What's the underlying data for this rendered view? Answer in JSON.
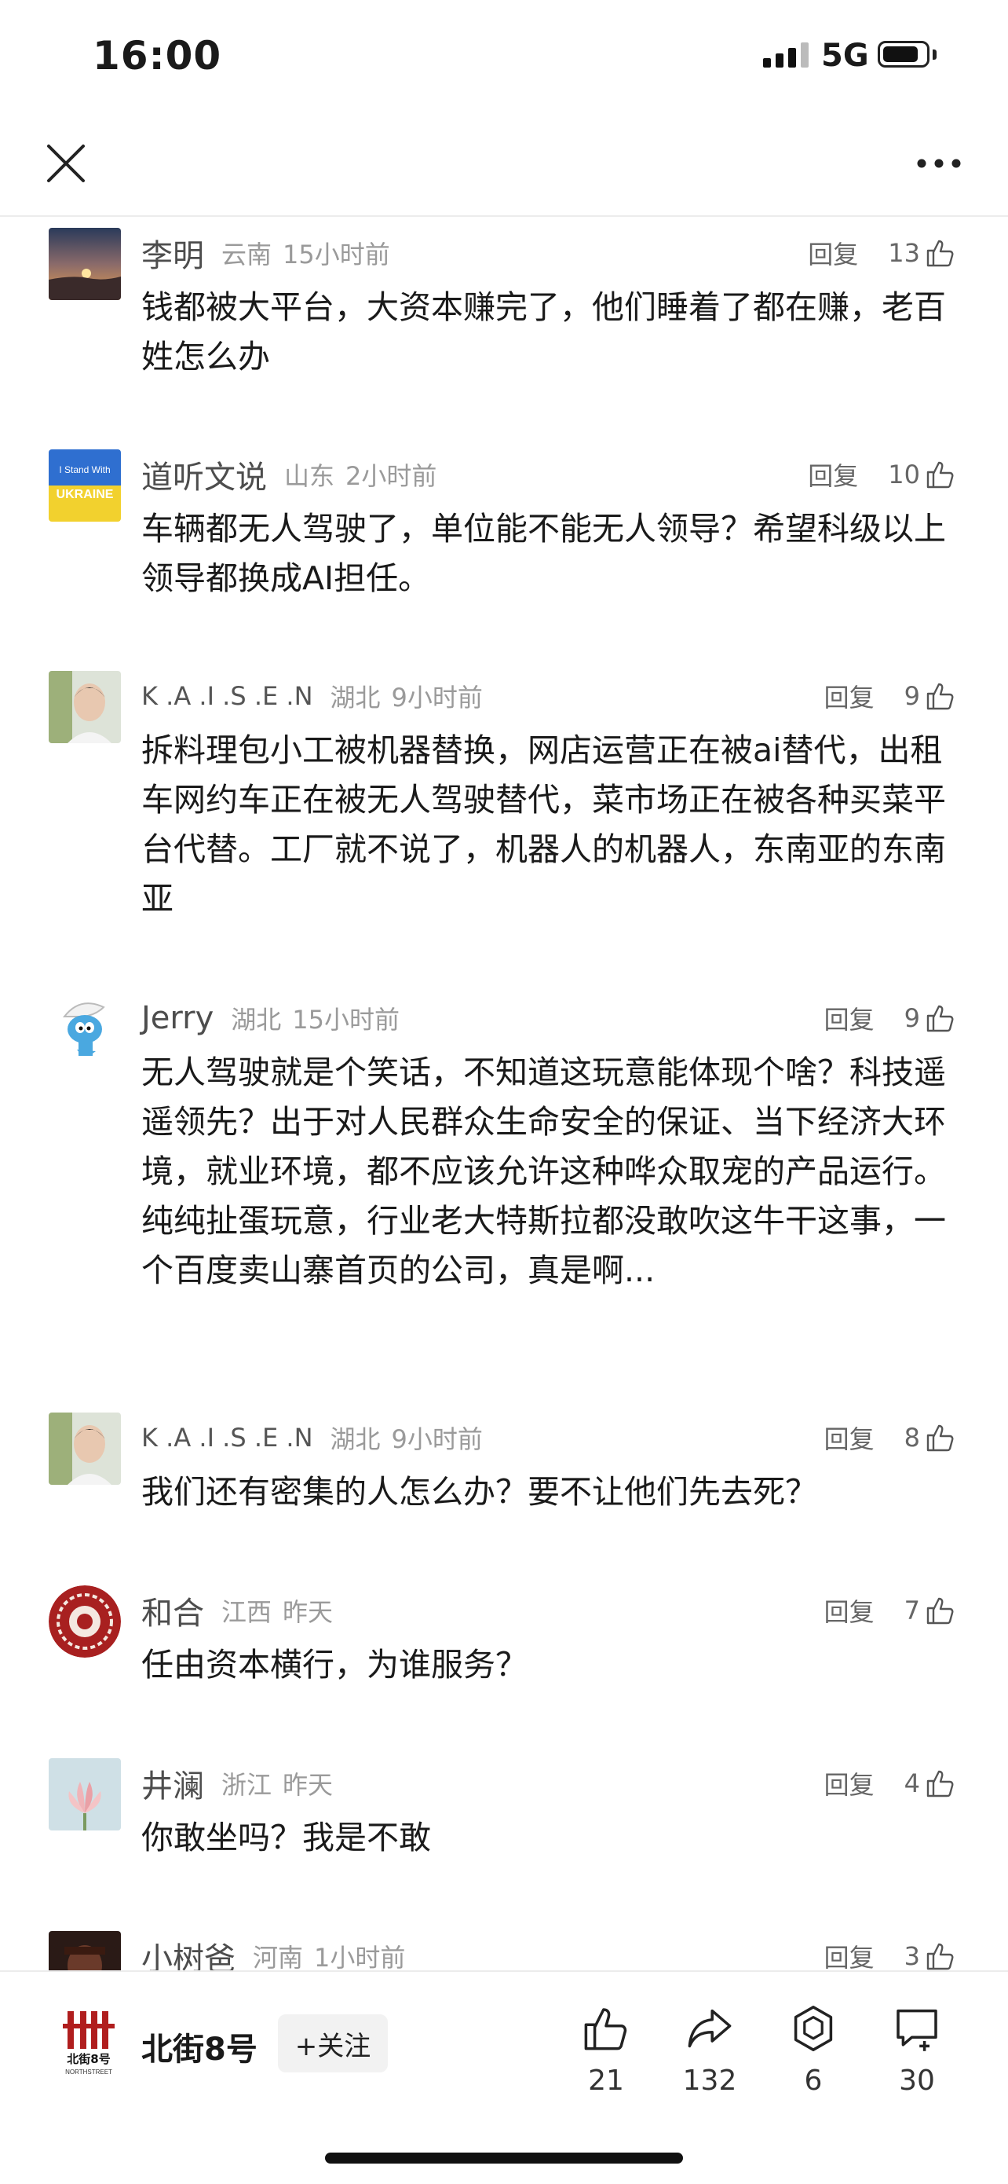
{
  "status_bar": {
    "time": "16:00",
    "network": "5G",
    "battery_level": 0.85
  },
  "nav": {
    "close_icon": "close-icon",
    "more_icon": "more-icon"
  },
  "comments": [
    {
      "name": "李明",
      "location": "云南",
      "time": "15小时前",
      "reply": "回复",
      "likes": "13",
      "text": "钱都被大平台，大资本赚完了，他们睡着了都在赚，老百姓怎么办",
      "avatar": "sunset-avatar"
    },
    {
      "name": "道听文说",
      "location": "山东",
      "time": "2小时前",
      "reply": "回复",
      "likes": "10",
      "text": "车辆都无人驾驶了，单位能不能无人领导？希望科级以上领导都换成AI担任。",
      "avatar": "ukraine-avatar",
      "avatar_text": [
        "I Stand With",
        "UKRAINE"
      ]
    },
    {
      "name": "K .A .I .S .E .N",
      "location": "湖北",
      "time": "9小时前",
      "reply": "回复",
      "likes": "9",
      "text": "拆料理包小工被机器替换，网店运营正在被ai替代，出租车网约车正在被无人驾驶替代，菜市场正在被各种买菜平台代替。工厂就不说了，机器人的机器人，东南亚的东南亚",
      "avatar": "person-avatar"
    },
    {
      "name": "Jerry",
      "location": "湖北",
      "time": "15小时前",
      "reply": "回复",
      "likes": "9",
      "text": "无人驾驶就是个笑话，不知道这玩意能体现个啥？科技遥遥领先？出于对人民群众生命安全的保证、当下经济大环境，就业环境，都不应该允许这种哗众取宠的产品运行。纯纯扯蛋玩意，行业老大特斯拉都没敢吹这牛干这事，一个百度卖山寨首页的公司，真是啊...",
      "avatar": "smurf-avatar"
    },
    {
      "name": "K .A .I .S .E .N",
      "location": "湖北",
      "time": "9小时前",
      "reply": "回复",
      "likes": "8",
      "text": "我们还有密集的人怎么办？要不让他们先去死？",
      "avatar": "person-avatar"
    },
    {
      "name": "和合",
      "location": "江西",
      "time": "昨天",
      "reply": "回复",
      "likes": "7",
      "text": "任由资本横行，为谁服务？",
      "avatar": "red-pattern-avatar"
    },
    {
      "name": "井澜",
      "location": "浙江",
      "time": "昨天",
      "reply": "回复",
      "likes": "4",
      "text": "你敢坐吗？我是不敢",
      "avatar": "lotus-avatar"
    },
    {
      "name": "小树爸",
      "location": "河南",
      "time": "1小时前",
      "reply": "回复",
      "likes": "3",
      "text": "",
      "avatar": "dark-avatar"
    }
  ],
  "bottom_bar": {
    "source_name": "北街8号",
    "source_logo_text": "北街8号",
    "source_logo_sub": "NORTHSTREET",
    "follow_label": "+关注",
    "like_count": "21",
    "share_count": "132",
    "collect_count": "6",
    "comment_count": "30"
  }
}
